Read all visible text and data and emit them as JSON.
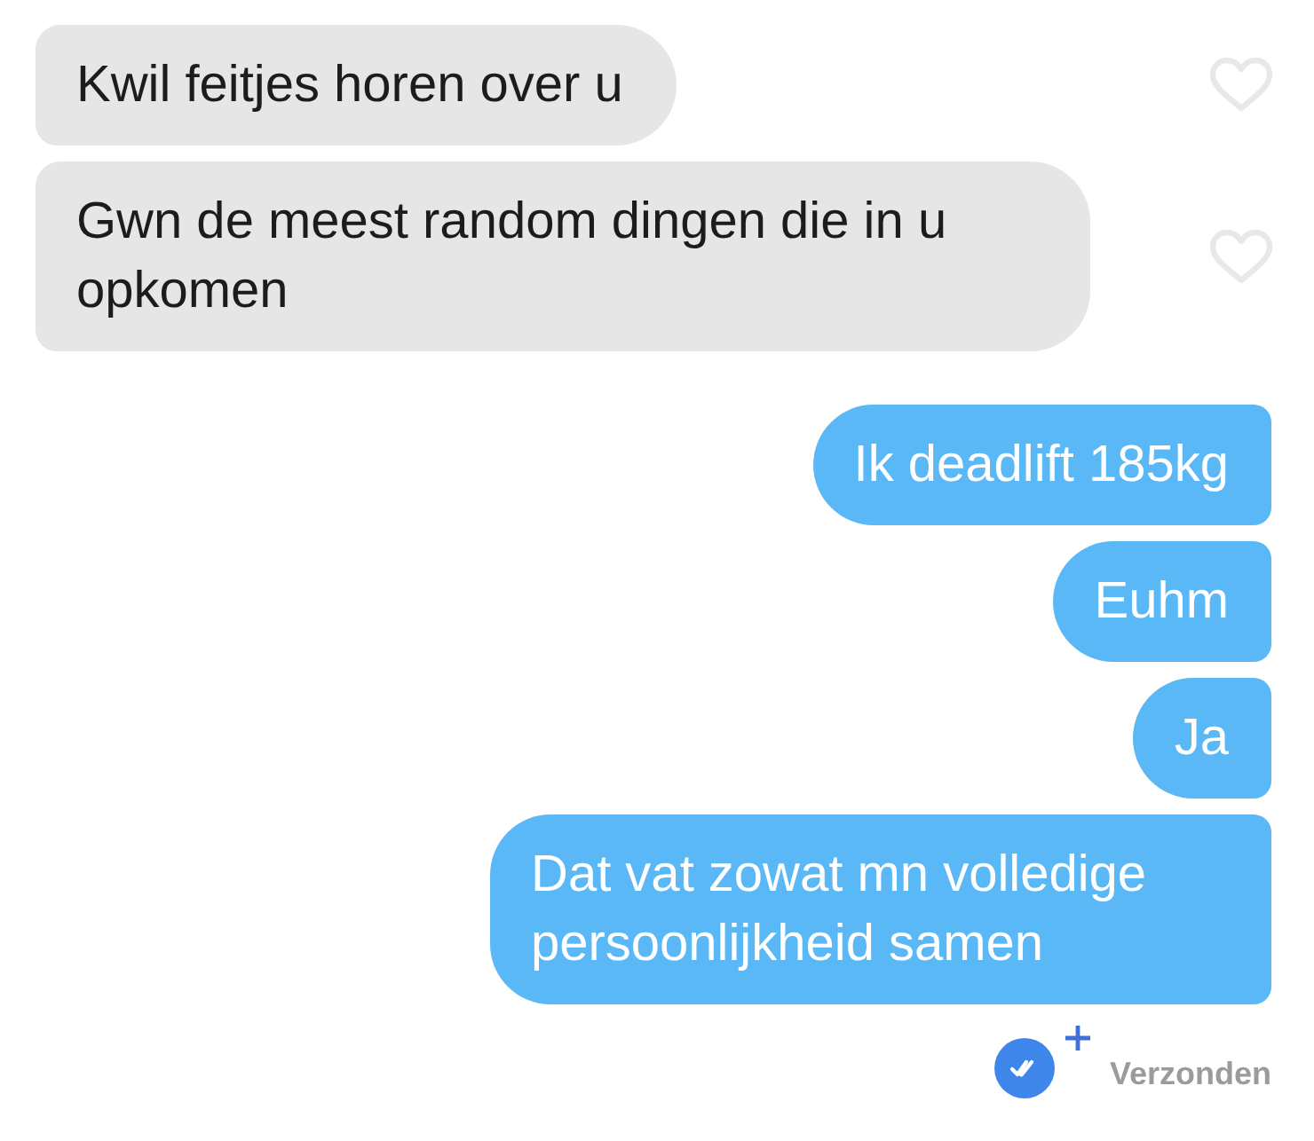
{
  "messages": [
    {
      "kind": "received",
      "text": "Kwil feitjes horen over u",
      "liked": false
    },
    {
      "kind": "received",
      "text": "Gwn de meest random dingen die in u opkomen",
      "liked": false
    },
    {
      "kind": "sent",
      "text": "Ik deadlift 185kg"
    },
    {
      "kind": "sent",
      "text": "Euhm"
    },
    {
      "kind": "sent",
      "text": "Ja"
    },
    {
      "kind": "sent",
      "text": "Dat vat zowat mn volledige persoonlijkheid samen"
    }
  ],
  "status": {
    "label": "Verzonden"
  }
}
